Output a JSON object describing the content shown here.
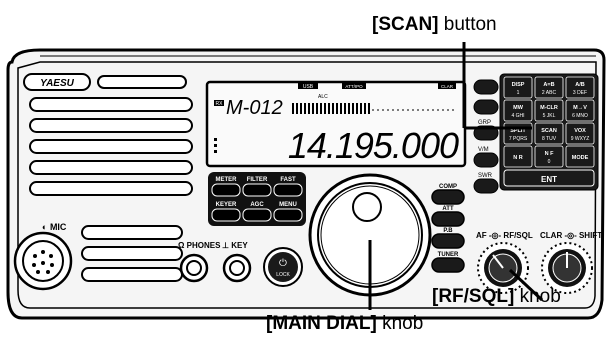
{
  "callouts": {
    "scan": {
      "bold": "[SCAN]",
      "rest": " button"
    },
    "rf_sql": {
      "bold": "[RF/SQL]",
      "rest": " knob"
    },
    "main_dial": {
      "bold": "[MAIN DIAL]",
      "rest": " knob"
    }
  },
  "radio": {
    "brand": "YAESU",
    "display": {
      "mode": "USB",
      "att": "ATT/IPO",
      "clar": "CLAR",
      "rx": "RX",
      "alc": "ALC",
      "memory_prefix": "M",
      "memory_channel": "M-012",
      "frequency": "14.195.000"
    },
    "mic_label": "MIC",
    "phones_label": "PHONES",
    "key_label": "KEY",
    "lock_label": "LOCK",
    "center_buttons": [
      "METER",
      "FILTER",
      "FAST",
      "KEYER",
      "AGC",
      "MENU"
    ],
    "side_buttons": [
      "COMP",
      "ATT",
      "P.B",
      "TUNER"
    ],
    "left_mini_labels": [
      "GRP",
      "V/M",
      "SWR"
    ],
    "keypad": [
      {
        "top": "DISP",
        "bottom": "1"
      },
      {
        "top": "A=B",
        "bottom": "2 ABC"
      },
      {
        "top": "A/B",
        "bottom": "3 DEF"
      },
      {
        "top": "MW",
        "bottom": "4 GHI"
      },
      {
        "top": "M-CLR",
        "bottom": "5 JKL"
      },
      {
        "top": "M→V",
        "bottom": "6 MNO"
      },
      {
        "top": "SPLIT",
        "bottom": "7 PQRS"
      },
      {
        "top": "SCAN",
        "bottom": "8 TUV"
      },
      {
        "top": "VOX",
        "bottom": "9 WXYZ"
      },
      {
        "top": "N R",
        "bottom": ""
      },
      {
        "top": "N F",
        "bottom": "0"
      },
      {
        "top": "MODE",
        "bottom": ""
      }
    ],
    "enter_label": "ENT",
    "knob_labels": {
      "af_rf": "AF -◎- RF/SQL",
      "clar_shift": "CLAR -◎- SHIFT"
    }
  },
  "colors": {
    "panel_face": "#f4f4f4",
    "display_bg": "#f7f7f7",
    "button_dark": "#1a1a1a",
    "line": "#000000"
  }
}
